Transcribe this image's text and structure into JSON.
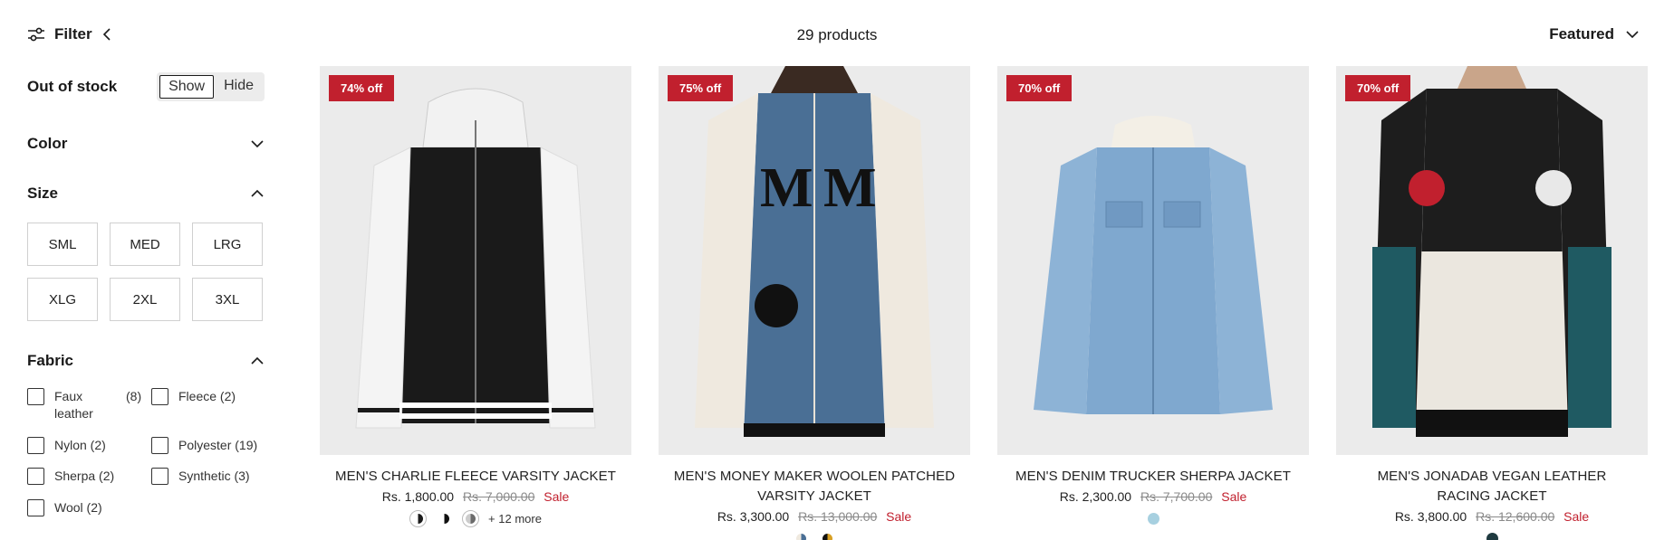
{
  "header": {
    "filter_label": "Filter",
    "product_count": "29 products",
    "sort_label": "Featured"
  },
  "sidebar": {
    "out_of_stock": {
      "title": "Out of stock",
      "show_label": "Show",
      "hide_label": "Hide",
      "selected": "Show"
    },
    "color": {
      "title": "Color",
      "expanded": false
    },
    "size": {
      "title": "Size",
      "expanded": true,
      "options": [
        "SML",
        "MED",
        "LRG",
        "XLG",
        "2XL",
        "3XL"
      ]
    },
    "fabric": {
      "title": "Fabric",
      "expanded": true,
      "options": [
        {
          "label": "Faux leather",
          "count": "(8)"
        },
        {
          "label": "Fleece (2)"
        },
        {
          "label": "Nylon (2)"
        },
        {
          "label": "Polyester (19)"
        },
        {
          "label": "Sherpa (2)"
        },
        {
          "label": "Synthetic (3)"
        },
        {
          "label": "Wool (2)"
        }
      ]
    }
  },
  "products": [
    {
      "badge": "74% off",
      "name": "MEN'S CHARLIE FLEECE VARSITY JACKET",
      "price": "Rs. 1,800.00",
      "compare_price": "Rs. 7,000.00",
      "sale_label": "Sale",
      "swatch_colors": [
        "#1b1b1b",
        "#111111",
        "#6b6b6b"
      ],
      "more_label": "+ 12 more"
    },
    {
      "badge": "75% off",
      "name": "MEN'S MONEY MAKER WOOLEN PATCHED VARSITY JACKET",
      "price": "Rs. 3,300.00",
      "compare_price": "Rs. 13,000.00",
      "sale_label": "Sale",
      "swatch_colors": [
        "#4a6f95",
        "#d8a024"
      ]
    },
    {
      "badge": "70% off",
      "name": "MEN'S DENIM TRUCKER SHERPA JACKET",
      "price": "Rs. 2,300.00",
      "compare_price": "Rs. 7,700.00",
      "sale_label": "Sale",
      "swatch_colors": [
        "#a7d0e0"
      ]
    },
    {
      "badge": "70% off",
      "name": "MEN'S JONADAB VEGAN LEATHER RACING JACKET",
      "price": "Rs. 3,800.00",
      "compare_price": "Rs. 12,600.00",
      "sale_label": "Sale",
      "swatch_colors": [
        "#1f3a40"
      ]
    }
  ],
  "colors": {
    "accent_sale": "#c1202e",
    "image_bg": "#ebebeb"
  }
}
